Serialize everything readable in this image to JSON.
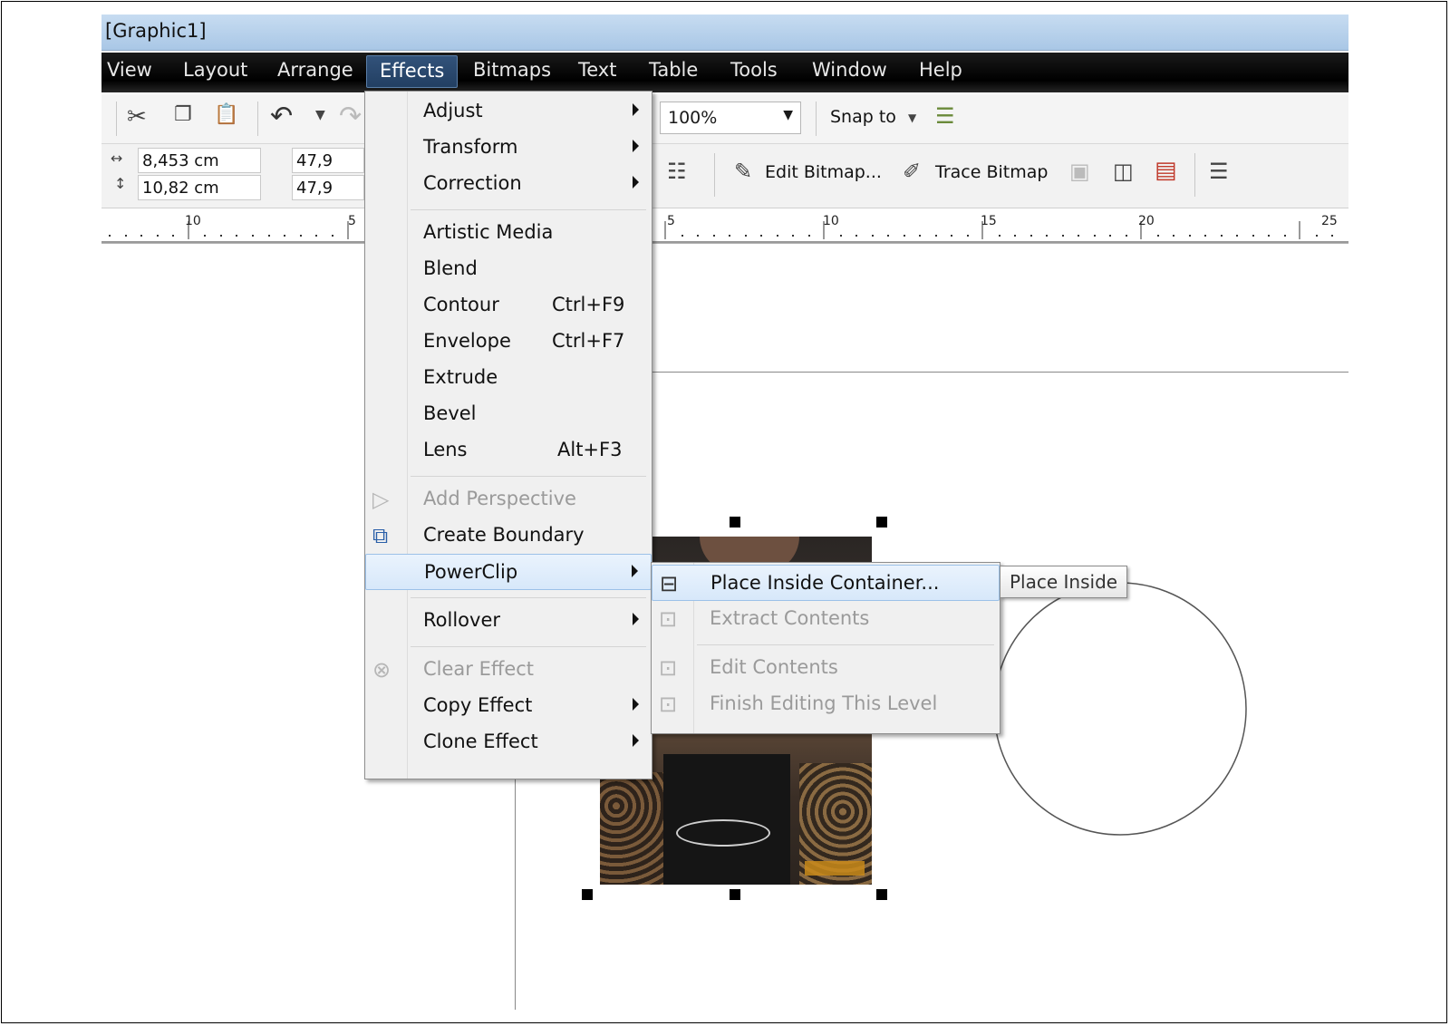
{
  "window": {
    "title": "[Graphic1]"
  },
  "menubar": {
    "items": [
      {
        "label": "View"
      },
      {
        "label": "Layout"
      },
      {
        "label": "Arrange"
      },
      {
        "label": "Effects"
      },
      {
        "label": "Bitmaps"
      },
      {
        "label": "Text"
      },
      {
        "label": "Table"
      },
      {
        "label": "Tools"
      },
      {
        "label": "Window"
      },
      {
        "label": "Help"
      }
    ],
    "active": "Effects"
  },
  "toolbar": {
    "zoom": "100%",
    "snap_label": "Snap to"
  },
  "property_bar": {
    "width_value": "8,453 cm",
    "height_value": "10,82 cm",
    "scale_x": "47,9",
    "scale_y": "47,9",
    "edit_bitmap_label": "Edit Bitmap...",
    "trace_bitmap_label": "Trace Bitmap"
  },
  "ruler": {
    "labels_left": [
      "10",
      "5"
    ],
    "labels_right": [
      "5",
      "10",
      "15",
      "20",
      "25"
    ]
  },
  "effects_menu": {
    "items": [
      {
        "label": "Adjust",
        "submenu": true
      },
      {
        "label": "Transform",
        "submenu": true
      },
      {
        "label": "Correction",
        "submenu": true
      },
      {
        "label": "Artistic Media"
      },
      {
        "label": "Blend"
      },
      {
        "label": "Contour",
        "shortcut": "Ctrl+F9"
      },
      {
        "label": "Envelope",
        "shortcut": "Ctrl+F7"
      },
      {
        "label": "Extrude"
      },
      {
        "label": "Bevel"
      },
      {
        "label": "Lens",
        "shortcut": "Alt+F3"
      },
      {
        "label": "Add Perspective",
        "disabled": true
      },
      {
        "label": "Create Boundary"
      },
      {
        "label": "PowerClip",
        "submenu": true,
        "highlighted": true
      },
      {
        "label": "Rollover",
        "submenu": true
      },
      {
        "label": "Clear Effect",
        "disabled": true
      },
      {
        "label": "Copy Effect",
        "submenu": true
      },
      {
        "label": "Clone Effect",
        "submenu": true
      }
    ]
  },
  "powerclip_menu": {
    "items": [
      {
        "label": "Place Inside Container...",
        "highlighted": true
      },
      {
        "label": "Extract Contents",
        "disabled": true
      },
      {
        "label": "Edit Contents",
        "disabled": true
      },
      {
        "label": "Finish Editing This Level",
        "disabled": true
      }
    ]
  },
  "tooltip": {
    "text": "Place Inside"
  },
  "icons": {
    "cut": "scissors-icon",
    "copy": "copy-icon",
    "paste": "paste-icon",
    "undo": "undo-icon"
  }
}
